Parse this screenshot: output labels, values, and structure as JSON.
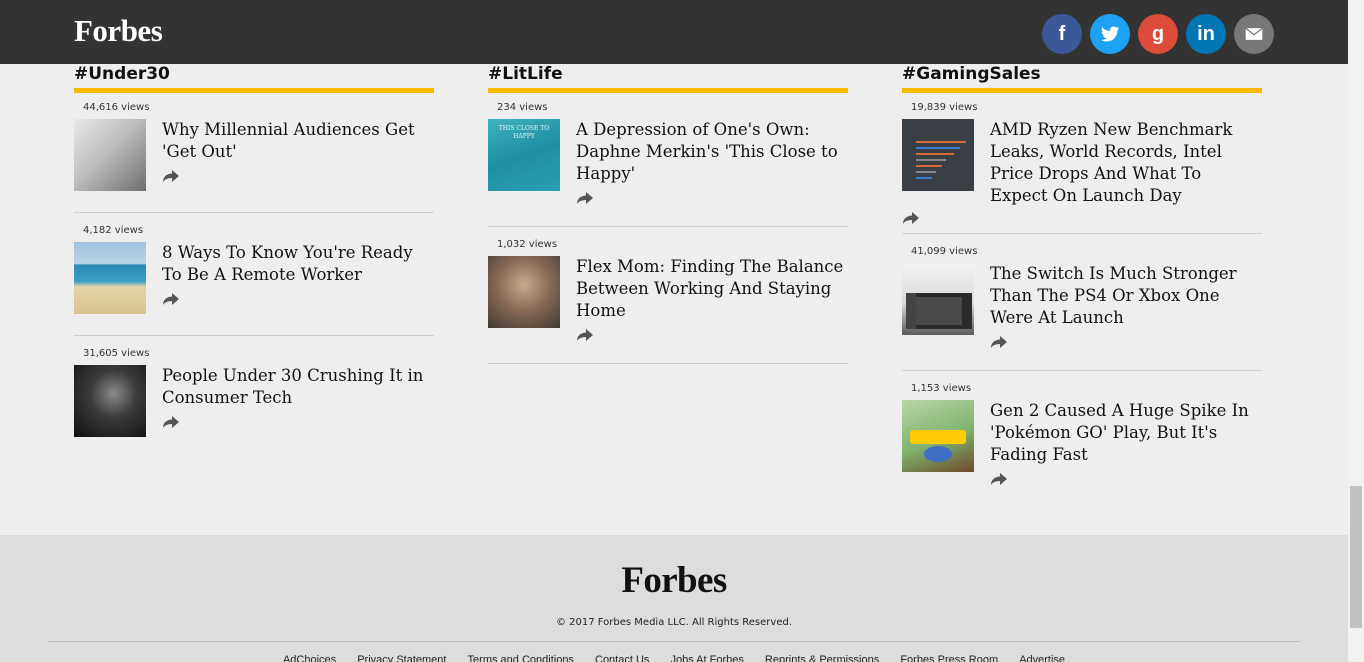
{
  "header": {
    "logo": "Forbes",
    "social": [
      {
        "name": "facebook",
        "glyph": "f",
        "color": "#3b5998"
      },
      {
        "name": "twitter",
        "color": "#1da1f2"
      },
      {
        "name": "google-plus",
        "glyph": "g",
        "color": "#dd4b39"
      },
      {
        "name": "linkedin",
        "glyph": "in",
        "color": "#0077b5"
      },
      {
        "name": "email",
        "color": "#777777"
      }
    ]
  },
  "accent_color": "#f9b800",
  "columns": [
    {
      "title": "#Under30",
      "items": [
        {
          "views": "44,616 views",
          "headline": "Why Millennial Audiences Get 'Get Out'"
        },
        {
          "views": "4,182 views",
          "headline": "8 Ways To Know You're Ready To Be A Remote Worker"
        },
        {
          "views": "31,605 views",
          "headline": "People Under 30 Crushing It in Consumer Tech"
        }
      ]
    },
    {
      "title": "#LitLife",
      "items": [
        {
          "views": "234 views",
          "headline": "A Depression of One's Own: Daphne Merkin's 'This Close to Happy'",
          "thumb_text": "THIS CLOSE TO HAPPY"
        },
        {
          "views": "1,032 views",
          "headline": "Flex Mom: Finding The Balance Between Working And Staying Home"
        }
      ]
    },
    {
      "title": "#GamingSales",
      "items": [
        {
          "views": "19,839 views",
          "headline": "AMD Ryzen New Benchmark Leaks, World Records, Intel Price Drops And What To Expect On Launch Day"
        },
        {
          "views": "41,099 views",
          "headline": "The Switch Is Much Stronger Than The PS4 Or Xbox One Were At Launch"
        },
        {
          "views": "1,153 views",
          "headline": "Gen 2 Caused A Huge Spike In 'Pokémon GO' Play, But It's Fading Fast"
        }
      ]
    }
  ],
  "footer": {
    "logo": "Forbes",
    "copyright": "© 2017 Forbes Media LLC. All Rights Reserved.",
    "links": [
      "AdChoices",
      "Privacy Statement",
      "Terms and Conditions",
      "Contact Us",
      "Jobs At Forbes",
      "Reprints & Permissions",
      "Forbes Press Room",
      "Advertise"
    ]
  }
}
